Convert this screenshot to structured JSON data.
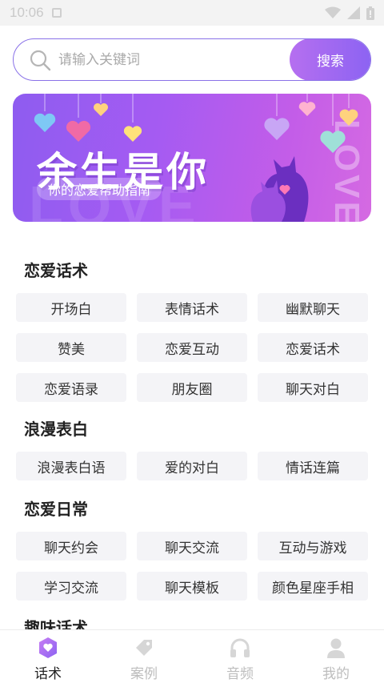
{
  "status_bar": {
    "time": "10:06"
  },
  "search": {
    "placeholder": "请输入关键词",
    "button_label": "搜索"
  },
  "banner": {
    "title": "余生是你",
    "subtitle": "你的恋爱帮助指南",
    "watermark": "LOVE",
    "vertical_text": "LOVE"
  },
  "sections": [
    {
      "title": "恋爱话术",
      "items": [
        "开场白",
        "表情话术",
        "幽默聊天",
        "赞美",
        "恋爱互动",
        "恋爱话术",
        "恋爱语录",
        "朋友圈",
        "聊天对白"
      ]
    },
    {
      "title": "浪漫表白",
      "items": [
        "浪漫表白语",
        "爱的对白",
        "情话连篇"
      ]
    },
    {
      "title": "恋爱日常",
      "items": [
        "聊天约会",
        "聊天交流",
        "互动与游戏",
        "学习交流",
        "聊天模板",
        "颜色星座手相"
      ]
    },
    {
      "title": "趣味话术",
      "items": []
    }
  ],
  "bottom_nav": [
    {
      "label": "话术",
      "icon": "chat-shield-icon",
      "active": true
    },
    {
      "label": "案例",
      "icon": "tag-icon",
      "active": false
    },
    {
      "label": "音频",
      "icon": "headphones-icon",
      "active": false
    },
    {
      "label": "我的",
      "icon": "user-icon",
      "active": false
    }
  ],
  "colors": {
    "accent": "#8c63f2",
    "accent_light": "#b66ff0",
    "chip_bg": "#f4f4f7"
  }
}
